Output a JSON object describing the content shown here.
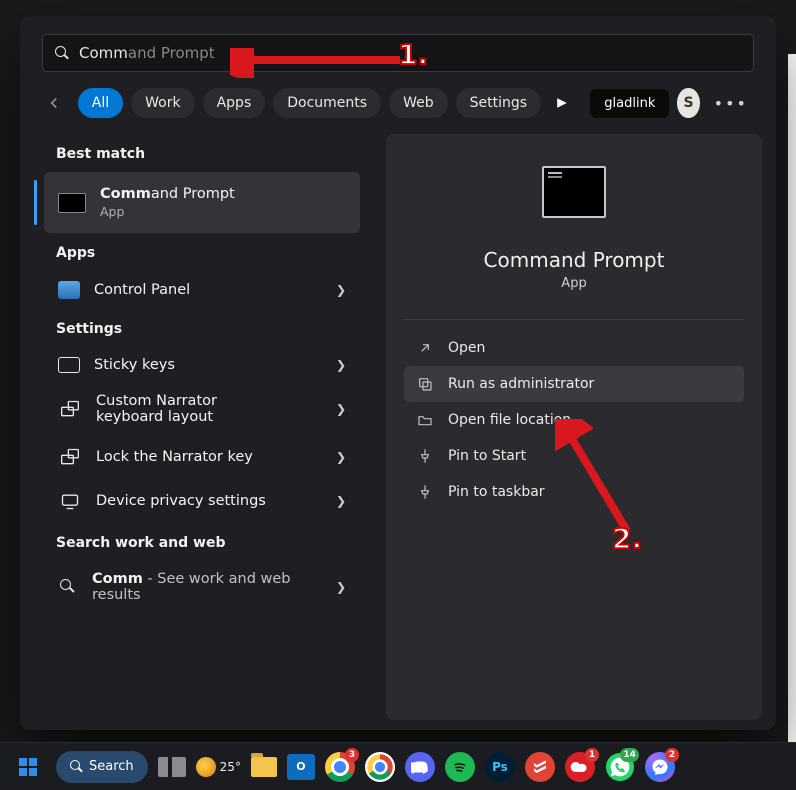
{
  "search": {
    "typed": "Comm",
    "completion": "and Prompt"
  },
  "tabs": {
    "items": [
      "All",
      "Work",
      "Apps",
      "Documents",
      "Web",
      "Settings"
    ],
    "active": "All",
    "account_pill": "gladlink",
    "avatar_initial": "S"
  },
  "annotations": {
    "step1": "1.",
    "step2": "2."
  },
  "left": {
    "best_match_h": "Best match",
    "best_match": {
      "title_bold": "Comm",
      "title_rest": "and Prompt",
      "subtitle": "App"
    },
    "apps_h": "Apps",
    "apps": [
      {
        "title": "Control Panel",
        "icon": "control-panel-icon"
      }
    ],
    "settings_h": "Settings",
    "settings": [
      {
        "title": "Sticky keys",
        "icon": "keyboard-icon"
      },
      {
        "title": "Custom Narrator keyboard layout",
        "icon": "narrator-keyboard-icon"
      },
      {
        "title": "Lock the Narrator key",
        "icon": "narrator-lock-icon"
      },
      {
        "title": "Device privacy settings",
        "icon": "privacy-icon"
      }
    ],
    "sww_h": "Search work and web",
    "sww": {
      "title_bold": "Comm",
      "title_rest": " - See work and web results"
    }
  },
  "preview": {
    "title": "Command Prompt",
    "type": "App",
    "actions": [
      {
        "label": "Open",
        "icon": "open-external-icon"
      },
      {
        "label": "Run as administrator",
        "icon": "admin-shield-icon"
      },
      {
        "label": "Open file location",
        "icon": "folder-icon"
      },
      {
        "label": "Pin to Start",
        "icon": "pin-icon"
      },
      {
        "label": "Pin to taskbar",
        "icon": "pin-icon"
      }
    ],
    "hover_index": 1
  },
  "taskbar": {
    "search_label": "Search",
    "weather_temp": "25°",
    "badges": {
      "chrome": "3",
      "whatsapp": "14",
      "messenger": "2",
      "web": "1"
    }
  }
}
